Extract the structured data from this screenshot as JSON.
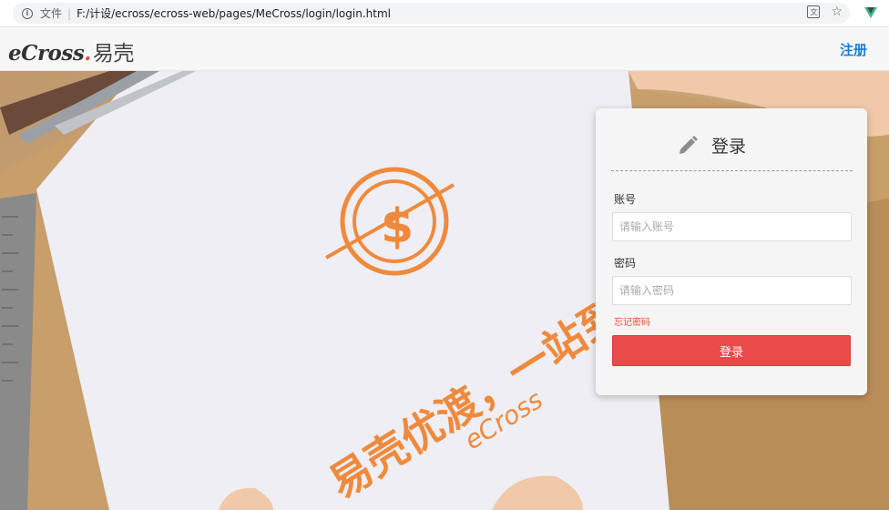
{
  "browser": {
    "scheme_label": "文件",
    "url": "F:/计设/ecross/ecross-web/pages/MeCross/login/login.html",
    "info_icon": "info-icon",
    "translate_icon": "translate-icon",
    "star_icon": "star-icon",
    "extension_icon": "vue-devtools-icon"
  },
  "header": {
    "logo_en": "eCross",
    "logo_dot": ".",
    "logo_cn": "易壳",
    "register_label": "注册"
  },
  "hero": {
    "slogan_cn": "易壳优渡，一站到家",
    "slogan_en": "eCross"
  },
  "login": {
    "title": "登录",
    "title_icon": "pencil-icon",
    "account_label": "账号",
    "account_placeholder": "请输入账号",
    "account_value": "",
    "password_label": "密码",
    "password_placeholder": "请输入密码",
    "password_value": "",
    "forgot_label": "忘记密码",
    "submit_label": "登录"
  },
  "colors": {
    "accent_red": "#ea4a4a",
    "link_blue": "#1a7fd4",
    "brand_orange": "#ef8a3c"
  }
}
